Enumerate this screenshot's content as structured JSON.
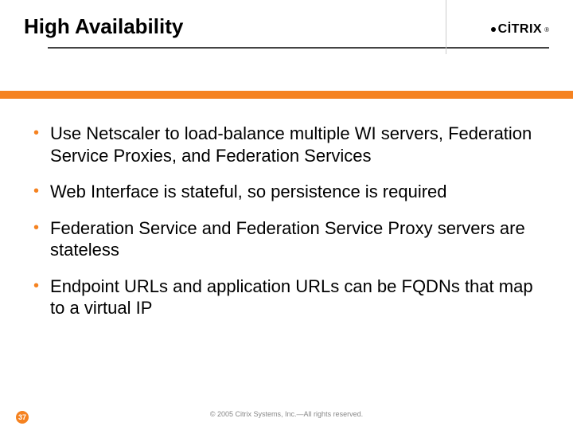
{
  "header": {
    "title": "High Availability",
    "logo_text": "CİTRIX",
    "logo_reg": "®"
  },
  "bullets": [
    "Use Netscaler to load-balance multiple WI servers, Federation Service Proxies, and Federation Services",
    "Web Interface is stateful, so persistence is required",
    "Federation Service and Federation Service Proxy servers are stateless",
    "Endpoint URLs and application URLs can be FQDNs that map to a virtual IP"
  ],
  "footer": {
    "copyright": "© 2005 Citrix Systems, Inc.—All rights reserved.",
    "page": "37"
  }
}
